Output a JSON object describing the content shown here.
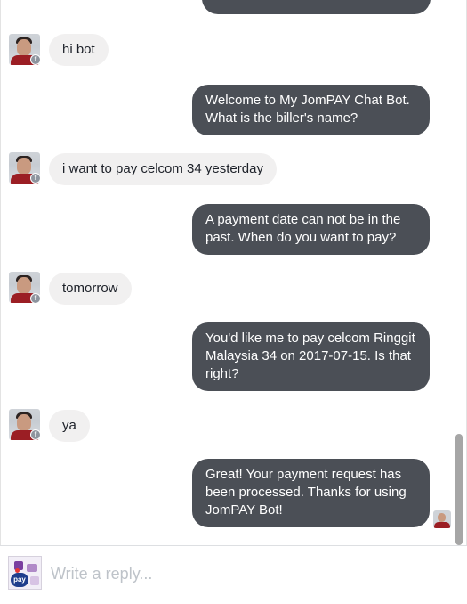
{
  "messages": [
    {
      "from": "user",
      "text": "hi bot"
    },
    {
      "from": "bot",
      "text": "Welcome to My JomPAY Chat Bot. What is the biller's name?"
    },
    {
      "from": "user",
      "text": "i want to pay celcom 34 yesterday"
    },
    {
      "from": "bot",
      "text": "A payment date can not be in the past.  When do you want to pay?"
    },
    {
      "from": "user",
      "text": "tomorrow"
    },
    {
      "from": "bot",
      "text": "You'd like me to pay celcom Ringgit Malaysia 34 on 2017-07-15. Is that right?"
    },
    {
      "from": "user",
      "text": "ya"
    },
    {
      "from": "bot",
      "text": "Great!  Your payment request has been processed.  Thanks for using JomPAY Bot!"
    }
  ],
  "composer": {
    "placeholder": "Write a reply...",
    "page_icon_label": "pay"
  },
  "badge_glyph": "f",
  "colors": {
    "bot_bubble": "#4b4f56",
    "user_bubble": "#f1f0f0",
    "placeholder": "#bec3c9"
  }
}
